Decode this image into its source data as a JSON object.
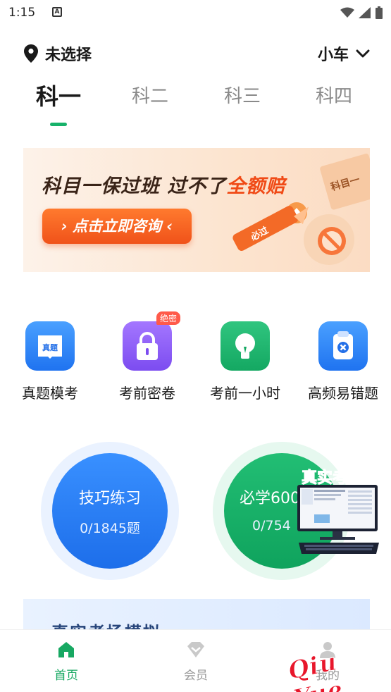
{
  "status_bar": {
    "time": "1:15",
    "notification_letter": "A"
  },
  "header": {
    "location": "未选择",
    "vehicle": "小车"
  },
  "tabs": [
    {
      "label": "科一",
      "active": true
    },
    {
      "label": "科二",
      "active": false
    },
    {
      "label": "科三",
      "active": false
    },
    {
      "label": "科四",
      "active": false
    }
  ],
  "banner": {
    "title_part1": "科目一保过班 过不了",
    "title_highlight": "全额赔",
    "button_label": "› 点击立即咨询 ‹",
    "sign_label": "科目一",
    "pencil_label": "必过"
  },
  "quick_actions": [
    {
      "label": "真题模考",
      "icon": "book-icon",
      "color": "#2a84f7",
      "icon_text": "真题"
    },
    {
      "label": "考前密卷",
      "icon": "lock-icon",
      "color": "#8b5cf6",
      "badge": "绝密"
    },
    {
      "label": "考前一小时",
      "icon": "lightbulb-icon",
      "color": "#19b36c"
    },
    {
      "label": "高频易错题",
      "icon": "close-badge-icon",
      "color": "#2a84f7"
    }
  ],
  "practice": [
    {
      "title": "技巧练习",
      "progress": "0/1845题",
      "color": "#2b7df2"
    },
    {
      "title": "必学600",
      "progress": "0/754",
      "color": "#15b26a"
    }
  ],
  "exam_overlay": {
    "title": "真实考场"
  },
  "promo_strip": {
    "text": "真实考场模拟"
  },
  "bottom_nav": [
    {
      "label": "首页",
      "icon": "home-icon",
      "active": true
    },
    {
      "label": "会员",
      "icon": "diamond-icon",
      "active": false
    },
    {
      "label": "我的",
      "icon": "profile-icon",
      "active": false
    }
  ],
  "watermark": "Qiu Yue",
  "colors": {
    "accent_green": "#17b26a",
    "banner_orange": "#f0521a"
  }
}
